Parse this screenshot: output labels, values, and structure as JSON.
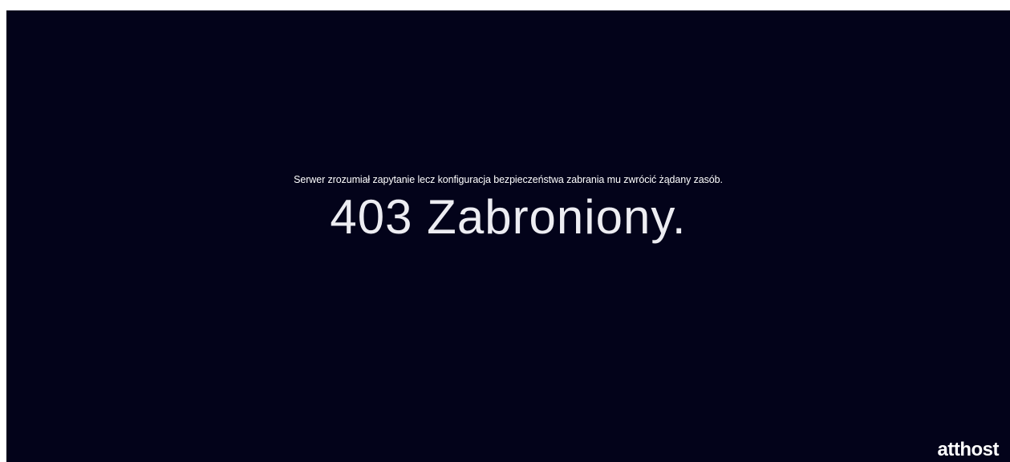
{
  "error": {
    "description": "Serwer zrozumiał zapytanie lecz konfiguracja bezpieczeństwa zabrania mu zwrócić żądany zasób.",
    "title": "403 Zabroniony."
  },
  "brand": {
    "logo_text": "atthost"
  },
  "colors": {
    "background": "#03031a",
    "text": "#ffffff",
    "frame": "#ffffff"
  }
}
